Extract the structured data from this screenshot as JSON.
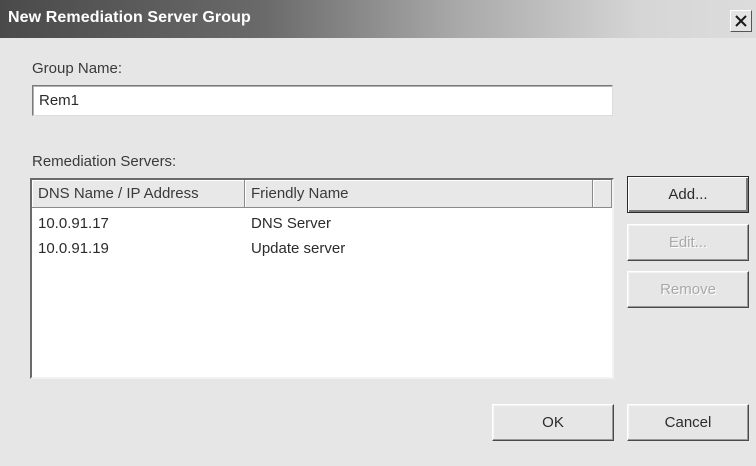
{
  "window": {
    "title": "New Remediation Server Group",
    "close_glyph": "×"
  },
  "group_name": {
    "label": "Group Name:",
    "value": "Rem1"
  },
  "servers": {
    "label": "Remediation Servers:",
    "columns": [
      "DNS Name / IP Address",
      "Friendly Name"
    ],
    "rows": [
      {
        "address": "10.0.91.17",
        "friendly_name": "DNS Server"
      },
      {
        "address": "10.0.91.19",
        "friendly_name": "Update server"
      }
    ]
  },
  "buttons": {
    "add": "Add...",
    "edit": "Edit...",
    "remove": "Remove",
    "ok": "OK",
    "cancel": "Cancel"
  },
  "icons": {
    "close": "close-icon"
  }
}
